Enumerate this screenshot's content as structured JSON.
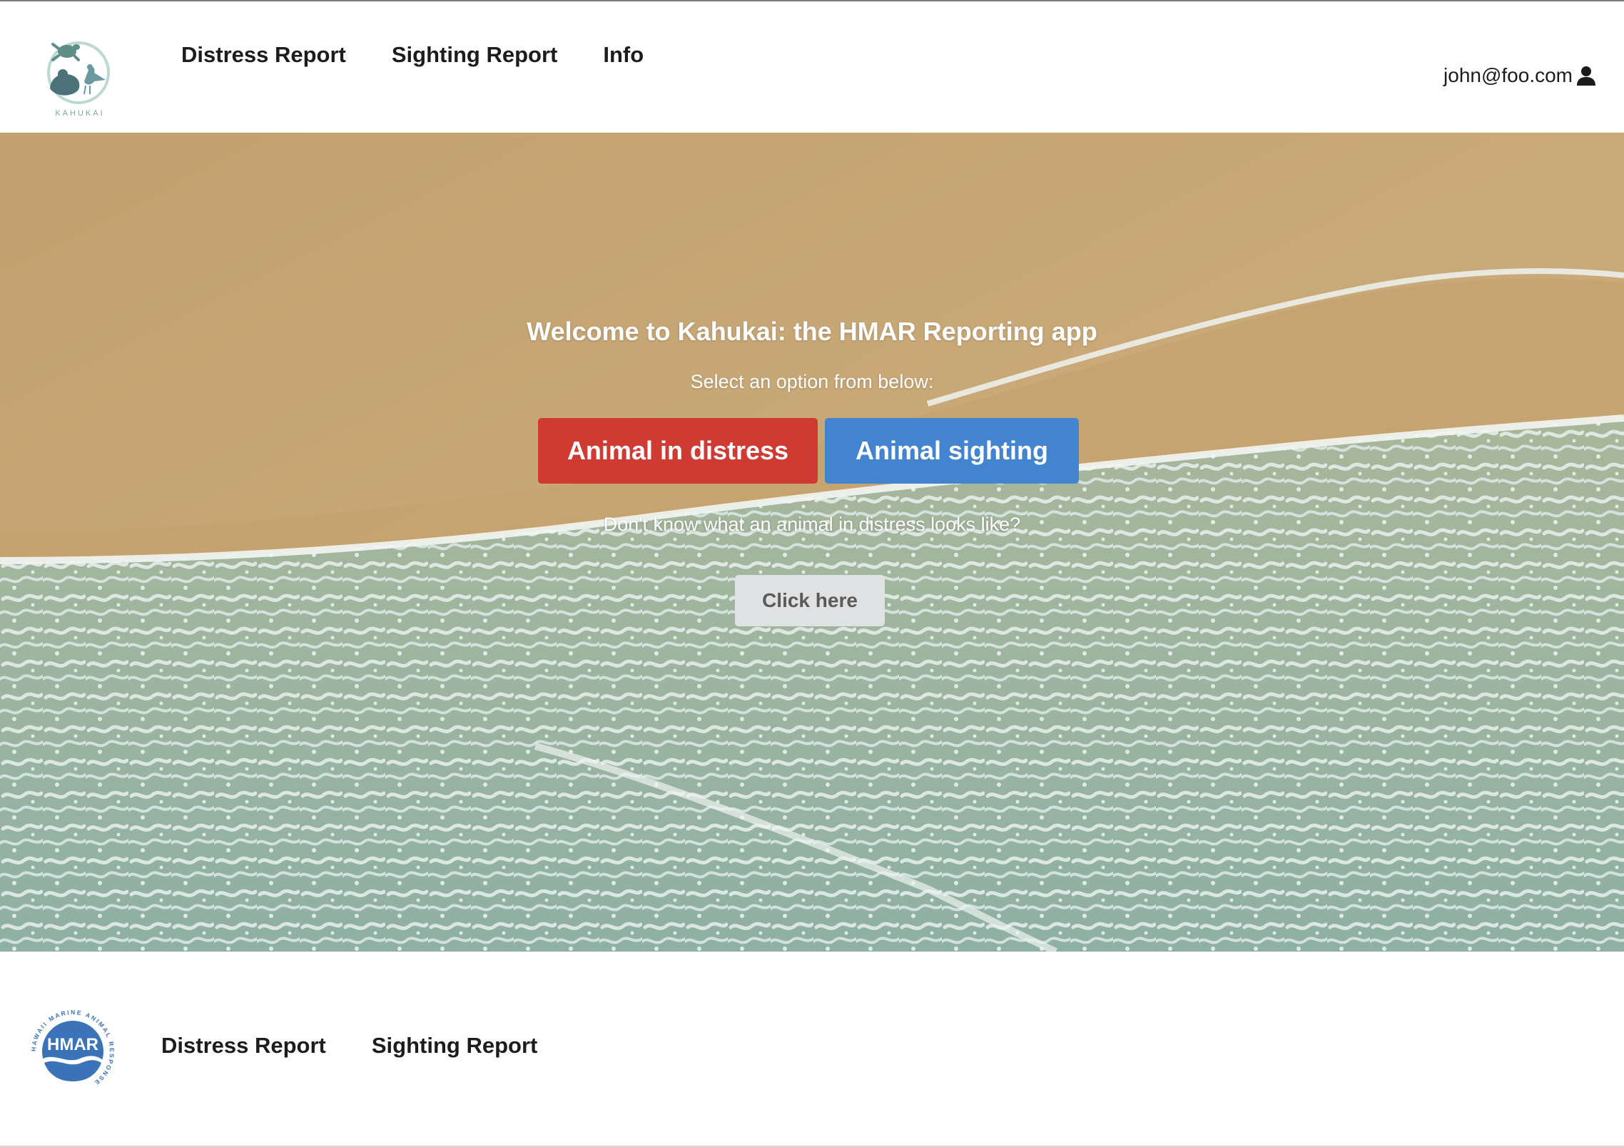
{
  "header": {
    "logo": {
      "icon": "kahukai-logo",
      "wordmark": "KAHUKAI"
    },
    "nav": [
      {
        "label": "Distress Report"
      },
      {
        "label": "Sighting Report"
      },
      {
        "label": "Info"
      }
    ],
    "user": {
      "email": "john@foo.com",
      "icon": "user-icon"
    }
  },
  "hero": {
    "background": "aerial beach sand and surf photo",
    "title": "Welcome to Kahukai: the HMAR Reporting app",
    "subtitle": "Select an option from below:",
    "buttons": {
      "distress": "Animal in distress",
      "sighting": "Animal sighting"
    },
    "help_text": "Don't know what an animal in distress looks like?",
    "help_button": "Click here"
  },
  "footer": {
    "logo": {
      "icon": "hmar-logo",
      "text": "HMAR",
      "ring_text": "HAWAII MARINE ANIMAL RESPONSE"
    },
    "nav": [
      {
        "label": "Distress Report"
      },
      {
        "label": "Sighting Report"
      }
    ]
  },
  "colors": {
    "distress_button": "#cf3a32",
    "sighting_button": "#4284d0",
    "help_button": "#e0e1e2",
    "nav_text": "#1b1c1d",
    "hmar_blue": "#3a73b8",
    "kahukai_teal": "#7fb3a8"
  }
}
